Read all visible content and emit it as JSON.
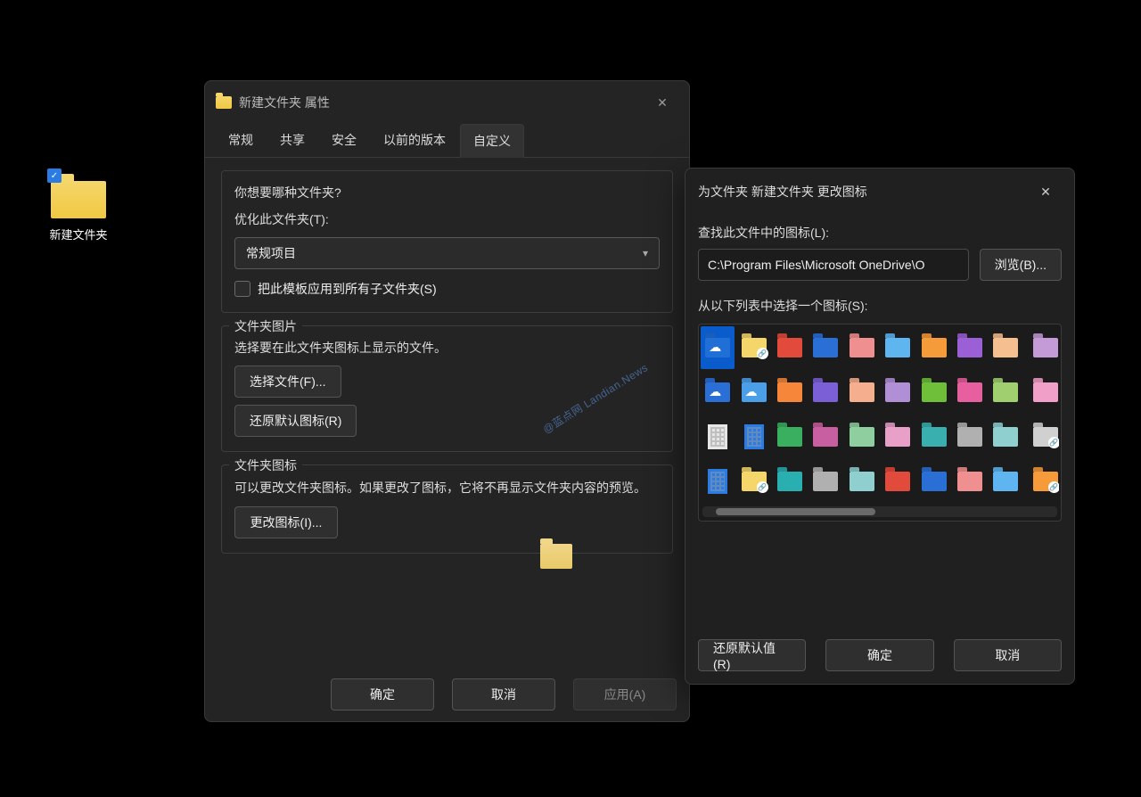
{
  "desktop": {
    "folder_label": "新建文件夹"
  },
  "props_dialog": {
    "title": "新建文件夹 属性",
    "tabs": [
      "常规",
      "共享",
      "安全",
      "以前的版本",
      "自定义"
    ],
    "active_tab_index": 4,
    "section1": {
      "prompt": "你想要哪种文件夹?",
      "optimize_label": "优化此文件夹(T):",
      "combo_value": "常规项目",
      "checkbox_label": "把此模板应用到所有子文件夹(S)"
    },
    "section2": {
      "title": "文件夹图片",
      "desc": "选择要在此文件夹图标上显示的文件。",
      "choose_file": "选择文件(F)...",
      "restore_default": "还原默认图标(R)"
    },
    "section3": {
      "title": "文件夹图标",
      "desc": "可以更改文件夹图标。如果更改了图标，它将不再显示文件夹内容的预览。",
      "change_icon": "更改图标(I)..."
    },
    "footer": {
      "ok": "确定",
      "cancel": "取消",
      "apply": "应用(A)"
    }
  },
  "icon_dialog": {
    "title": "为文件夹 新建文件夹 更改图标",
    "path_label": "查找此文件中的图标(L):",
    "path_value": "C:\\Program Files\\Microsoft OneDrive\\O",
    "browse": "浏览(B)...",
    "grid_label": "从以下列表中选择一个图标(S):",
    "footer": {
      "restore": "还原默认值(R)",
      "ok": "确定",
      "cancel": "取消"
    },
    "icons": [
      [
        {
          "kind": "cloud",
          "bg": "#1f6fd6",
          "sel": true
        },
        {
          "kind": "yellow-link",
          "bg": "#f5d66a"
        },
        {
          "kind": "folder",
          "bg": "#e24a3b"
        },
        {
          "kind": "folder",
          "bg": "#2a6fd6"
        },
        {
          "kind": "folder",
          "bg": "#f08f8f"
        },
        {
          "kind": "folder",
          "bg": "#5fb5f0"
        },
        {
          "kind": "folder",
          "bg": "#f59b3a"
        },
        {
          "kind": "folder",
          "bg": "#9b5fd6"
        },
        {
          "kind": "folder",
          "bg": "#f5bf8f"
        },
        {
          "kind": "folder",
          "bg": "#c49bd6"
        }
      ],
      [
        {
          "kind": "cloud-fold",
          "bg": "#2a6fd6"
        },
        {
          "kind": "cloud-fold",
          "bg": "#4a9fe8"
        },
        {
          "kind": "folder",
          "bg": "#f5863a"
        },
        {
          "kind": "folder",
          "bg": "#7b5fd6"
        },
        {
          "kind": "folder",
          "bg": "#f5af8f"
        },
        {
          "kind": "folder",
          "bg": "#b08fd6"
        },
        {
          "kind": "folder",
          "bg": "#6fbf3a"
        },
        {
          "kind": "folder",
          "bg": "#e85fa0"
        },
        {
          "kind": "folder",
          "bg": "#a0cf6f"
        },
        {
          "kind": "folder",
          "bg": "#f09fc8"
        }
      ],
      [
        {
          "kind": "building",
          "bg": "#e6e6e6"
        },
        {
          "kind": "building-blue",
          "bg": "#2a7be4"
        },
        {
          "kind": "folder",
          "bg": "#3aaf5f"
        },
        {
          "kind": "folder",
          "bg": "#c85fa0"
        },
        {
          "kind": "folder",
          "bg": "#8fcf9f"
        },
        {
          "kind": "folder",
          "bg": "#e89fc8"
        },
        {
          "kind": "folder",
          "bg": "#3aafb0"
        },
        {
          "kind": "folder",
          "bg": "#b0b0b0"
        },
        {
          "kind": "folder",
          "bg": "#8fcfcf"
        },
        {
          "kind": "link-folder",
          "bg": "#d0d0d0"
        }
      ],
      [
        {
          "kind": "building-blue",
          "bg": "#2a7be4"
        },
        {
          "kind": "yellow-link",
          "bg": "#f5d66a"
        },
        {
          "kind": "folder",
          "bg": "#2aafb0"
        },
        {
          "kind": "folder",
          "bg": "#b0b0b0"
        },
        {
          "kind": "folder",
          "bg": "#8fcfcf"
        },
        {
          "kind": "folder",
          "bg": "#e24a3b"
        },
        {
          "kind": "folder",
          "bg": "#2a6fd6"
        },
        {
          "kind": "folder",
          "bg": "#f08f8f"
        },
        {
          "kind": "folder",
          "bg": "#5fb5f0"
        },
        {
          "kind": "link-folder",
          "bg": "#f59b3a"
        }
      ]
    ]
  },
  "watermark": "@蓝点网 Landian.News"
}
